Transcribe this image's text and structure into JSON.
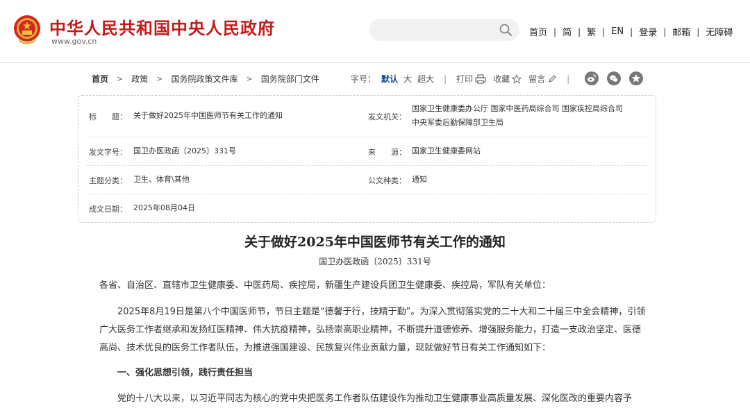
{
  "header": {
    "site_title": "中华人民共和国中央人民政府",
    "site_url": "www.gov.cn",
    "search_placeholder": "",
    "nav": [
      "首页",
      "简",
      "繁",
      "EN",
      "登录",
      "邮箱",
      "无障碍"
    ]
  },
  "breadcrumb": [
    "首页",
    "政策",
    "国务院政策文件库",
    "国务院部门文件"
  ],
  "toolbar": {
    "font_size_label": "字号：",
    "font_sizes": [
      "默认",
      "大",
      "超大"
    ],
    "print": "打印",
    "favorite": "收藏",
    "comment": "留言"
  },
  "meta": {
    "title_label": "标　　题：",
    "title_value": "关于做好2025年中国医师节有关工作的通知",
    "issuer_label": "发文机关：",
    "issuer_line1": "国家卫生健康委办公厅  国家中医药局综合司  国家疾控局综合司",
    "issuer_line2": "中央军委后勤保障部卫生局",
    "docno_label": "发文字号：",
    "docno_value": "国卫办医政函〔2025〕331号",
    "source_label": "来　　源：",
    "source_value": "国家卫生健康委网站",
    "category_label": "主题分类：",
    "category_value": "卫生、体育\\其他",
    "doctype_label": "公文种类：",
    "doctype_value": "通知",
    "date_label": "成文日期：",
    "date_value": "2025年08月04日"
  },
  "document": {
    "title": "关于做好2025年中国医师节有关工作的通知",
    "number": "国卫办医政函〔2025〕331号",
    "salutation": "各省、自治区、直辖市卫生健康委、中医药局、疾控局，新疆生产建设兵团卫生健康委、疾控局，军队有关单位：",
    "para1": "2025年8月19日是第八个中国医师节，节日主题是“德馨于行，技精于勤”。为深入贯彻落实党的二十大和二十届三中全会精神，引领广大医务工作者继承和发扬红医精神、伟大抗疫精神，弘扬崇高职业精神，不断提升道德修养、增强服务能力，打造一支政治坚定、医德高尚、技术优良的医务工作者队伍，为推进强国建设、民族复兴伟业贡献力量，现就做好节日有关工作通知如下：",
    "heading1": "一、强化思想引领，践行责任担当",
    "para2": "党的十八大以来，以习近平同志为核心的党中央把医务工作者队伍建设作为推动卫生健康事业高质量发展、深化医改的重要内容予"
  },
  "colors": {
    "brand_red": "#c41a1a",
    "link_blue": "#1a4a8a"
  }
}
